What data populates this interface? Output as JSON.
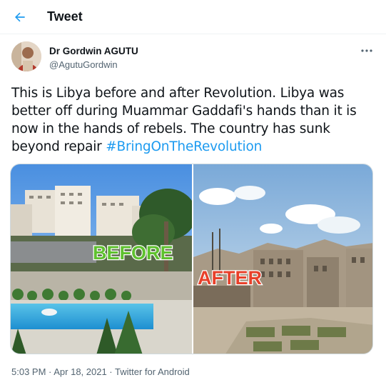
{
  "header": {
    "title": "Tweet"
  },
  "tweet": {
    "author_name": "Dr Gordwin AGUTU",
    "author_handle": "@AgutuGordwin",
    "text": "This is Libya before and after Revolution. Libya was better off during Muammar Gaddafi's hands than it is now in the hands of rebels. The country has sunk beyond repair ",
    "hashtag": "#BringOnTheRevolution",
    "image": {
      "label_before": "BEFORE",
      "label_after": "AFTER"
    },
    "timestamp": "5:03 PM · Apr 18, 2021 · Twitter for Android"
  },
  "icons": {
    "back": "back-arrow-icon",
    "more": "more-icon"
  },
  "colors": {
    "accent": "#1d9bf0",
    "label_before": "#5fc12f",
    "label_after": "#e8402a"
  }
}
